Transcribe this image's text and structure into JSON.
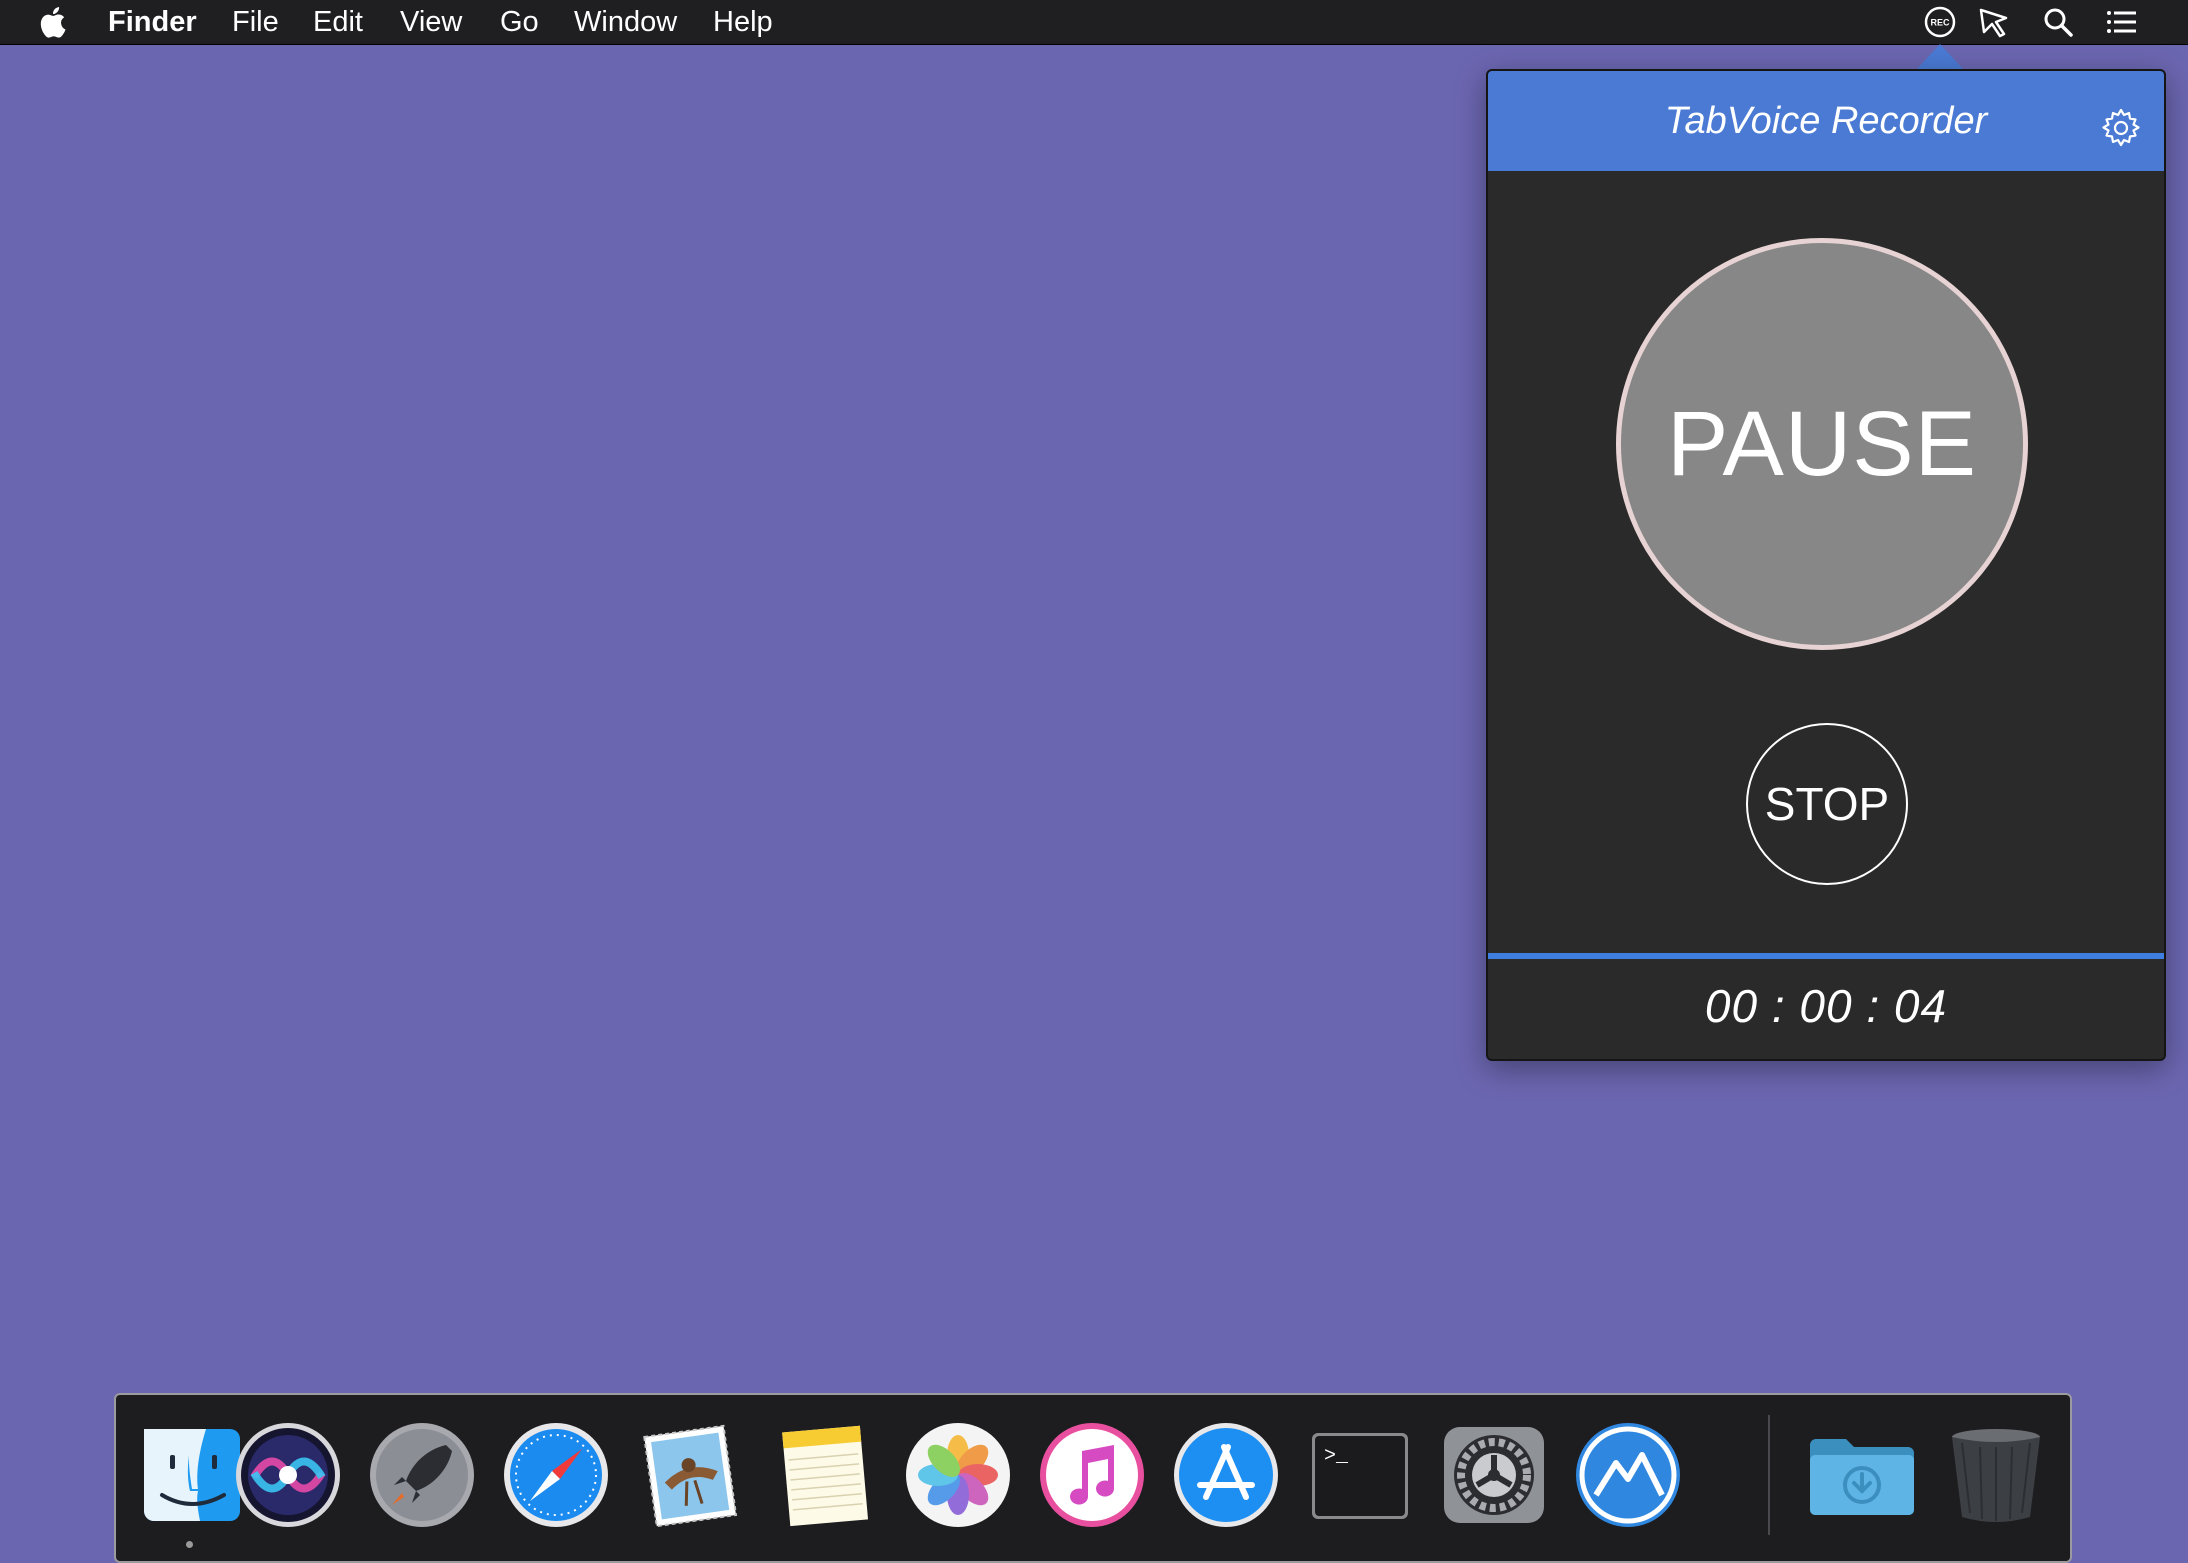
{
  "menubar": {
    "apple_icon": "apple-logo-icon",
    "app_name": "Finder",
    "menus": [
      "File",
      "Edit",
      "View",
      "Go",
      "Window",
      "Help"
    ],
    "status_icons": [
      "rec-icon",
      "screen-capture-icon",
      "spotlight-search-icon",
      "notification-center-icon"
    ],
    "rec_label": "REC"
  },
  "popover": {
    "title": "TabVoice Recorder",
    "pause_label": "PAUSE",
    "stop_label": "STOP",
    "timer": "00 : 00 : 04",
    "progress_fraction": 1.0,
    "colors": {
      "header": "#4a7ad4",
      "body": "#2a2a2b",
      "pause_fill": "#878787",
      "pause_ring": "#e7d3d3",
      "progress": "#3d7ee0"
    }
  },
  "dock": {
    "items": [
      "finder-icon",
      "siri-icon",
      "launchpad-icon",
      "safari-icon",
      "mail-icon",
      "notes-icon",
      "photos-icon",
      "itunes-icon",
      "app-store-icon",
      "terminal-icon",
      "system-preferences-icon",
      "app-icon",
      "downloads-folder-icon",
      "trash-icon"
    ],
    "terminal_prompt": ">_"
  },
  "desktop": {
    "background": "#6b66b0"
  }
}
